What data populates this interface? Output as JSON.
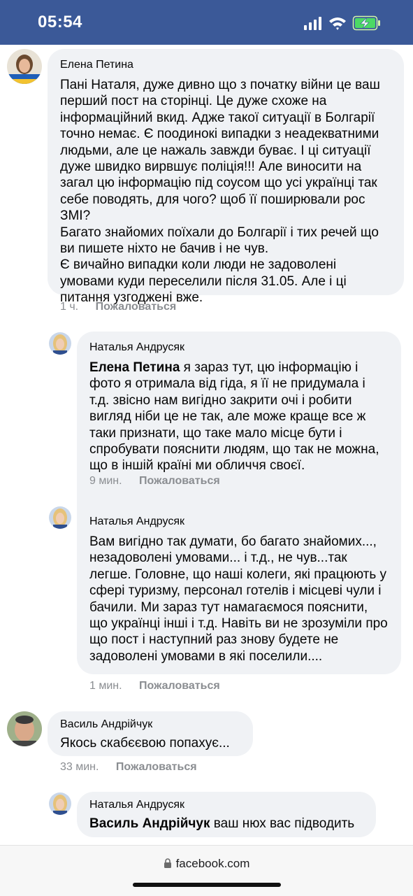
{
  "status_bar": {
    "time": "05:54"
  },
  "comments": [
    {
      "author": "Елена Петина",
      "text": "Пані Наталя, дуже дивно що з початку війни це ваш перший пост на сторінці. Це дуже схоже на інформаційний вкид. Адже такої ситуації в Болгарії точно немає. Є поодинокі випадки з неадекватними людьми, але це нажаль завжди буває. І ці ситуації дуже швидко вирвшує поліція!!! Але виносити на загал цю інформацію під соусом що усі українці так себе поводять, для чого? щоб її поширювали рос ЗМІ?\nБагато знайомих поїхали до Болгарії і тих речей що ви пишете ніхто не бачив і не чув.\nЄ вичайно випадки коли люди не задоволені умовами куди переселили після 31.05. Але і ці питання узгоджені вже.",
      "time": "1 ч.",
      "report": "Пожаловаться"
    },
    {
      "author": "Наталья Андрусяк",
      "mention": "Елена Петина",
      "text": " я зараз тут, цю інформацію і фото я отримала від гіда, я її не придумала і т.д. звісно нам вигідно закрити очі і робити вигляд ніби це не так, але може краще все ж таки признати, що таке мало місце бути і спробувати пояснити людям, що так не можна, що в іншій країні ми обличчя своєї.",
      "time": "9 мин.",
      "report": "Пожаловаться"
    },
    {
      "author": "Наталья Андрусяк",
      "text": "Вам вигідно так думати, бо багато знайомих..., незадоволені умовами... і т.д., не чув...так легше. Головне, що наші колеги, які працюють у сфері туризму, персонал готелів і місцеві чули і бачили. Ми зараз тут намагаємося пояснити, що українці інші і т.д. Навіть ви не зрозуміли про що пост і наступний раз знову будете не задоволені умовами в які поселили....",
      "time": "1 мин.",
      "report": "Пожаловаться"
    },
    {
      "author": "Василь Андрійчук",
      "text": "Якось скабєєвою попахує...",
      "time": "33 мин.",
      "report": "Пожаловаться"
    },
    {
      "author": "Наталья Андрусяк",
      "mention": "Василь Андрійчук",
      "text": " ваш нюх вас підводить"
    }
  ],
  "browser": {
    "url": "facebook.com"
  },
  "colors": {
    "status_bar_bg": "#3b5998",
    "bubble_bg": "#f0f2f5",
    "meta_text": "#8a8d91"
  }
}
